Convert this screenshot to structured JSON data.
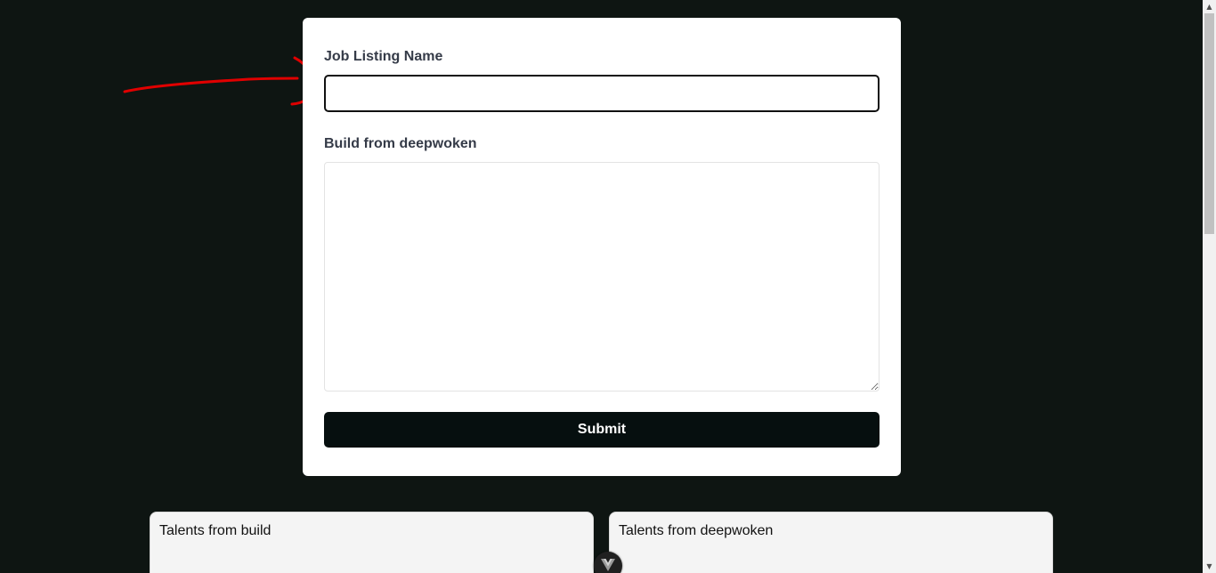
{
  "form": {
    "job_listing_label": "Job Listing Name",
    "job_listing_value": "",
    "build_label": "Build from deepwoken",
    "build_value": "",
    "submit_label": "Submit"
  },
  "talents": {
    "build_title": "Talents from build",
    "deepwoken_title": "Talents from deepwoken"
  },
  "icons": {
    "devtools": "vue-devtools-icon",
    "scroll_up": "scroll-up-arrow-icon",
    "scroll_down": "scroll-down-arrow-icon"
  },
  "colors": {
    "background": "#0e1512",
    "card": "#ffffff",
    "submit_button": "#060f0f",
    "annotation_stroke": "#e00000",
    "talent_card": "#f4f4f4"
  }
}
